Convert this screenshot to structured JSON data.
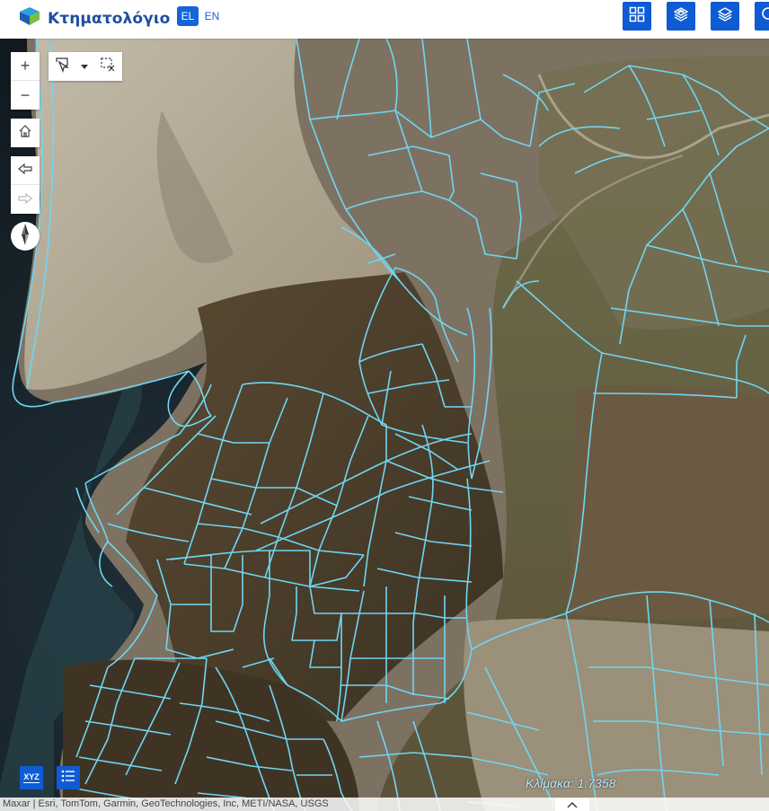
{
  "header": {
    "brand_title": "Κτηματολόγιο",
    "lang_el": "EL",
    "lang_en": "EN",
    "buttons": [
      {
        "icon": "grid-icon"
      },
      {
        "icon": "layers-stack-icon"
      },
      {
        "icon": "layers-icon"
      },
      {
        "icon": "search-icon"
      }
    ]
  },
  "map_controls": {
    "zoom_in": "+",
    "zoom_out": "−",
    "home_icon": "home-icon",
    "back_icon": "arrow-left-icon",
    "forward_icon": "arrow-right-icon",
    "compass_icon": "compass-icon"
  },
  "select_tool": {
    "select_icon": "select-pointer-icon",
    "dropdown_icon": "chevron-down-icon",
    "clear_icon": "clear-selection-icon"
  },
  "bottom_tools": {
    "xyz_label": "XYZ",
    "legend_icon": "list-icon"
  },
  "scale_text": "Κλίμακα: 1:7358",
  "attribution": "Maxar | Esri, TomTom, Garmin, GeoTechnologies, Inc, METI/NASA, USGS",
  "colors": {
    "brand_blue": "#1f4ea1",
    "button_blue": "#0f5bd3",
    "parcel_line": "#6fd6f2",
    "sea": "#18222a",
    "terrain_light": "#b7ad9a",
    "terrain_dark": "#4a3e2c"
  }
}
